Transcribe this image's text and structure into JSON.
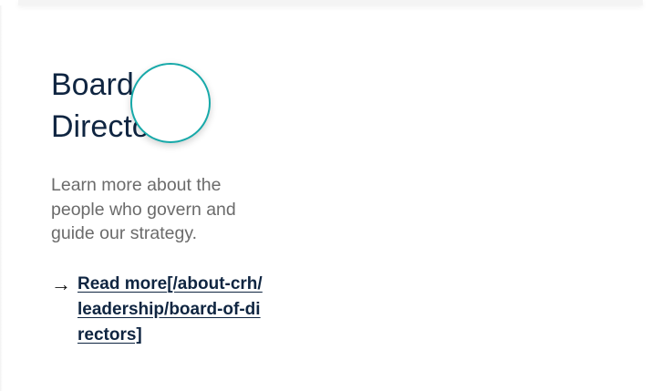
{
  "card": {
    "title": "Board of Directors",
    "description": "Learn more about the people who govern and guide our strategy.",
    "link": {
      "label": "Read more",
      "href": "[/about-crh/leadership/board-of-directors]",
      "arrow_icon": "arrow-right-icon"
    }
  },
  "colors": {
    "title": "#0f2541",
    "description": "#6b6b6b",
    "focus_ring": "#17a9a9"
  }
}
